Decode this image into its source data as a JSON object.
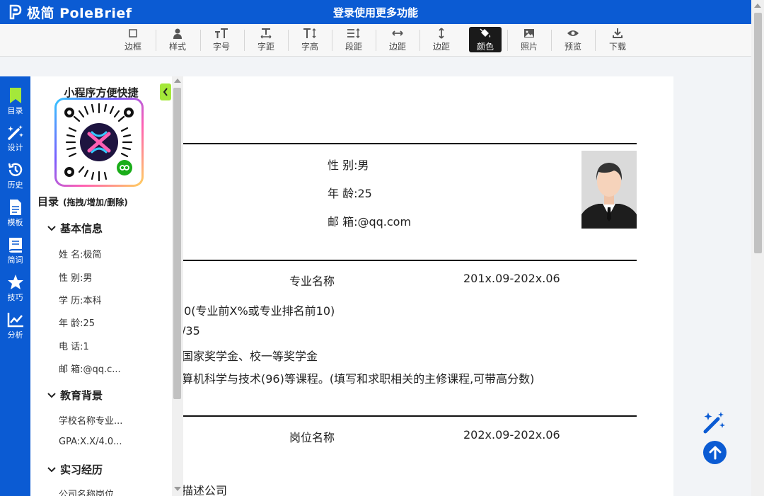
{
  "app": {
    "brand": "极简 PoleBrief",
    "login_text": "登录使用更多功能"
  },
  "toolbar": [
    {
      "label": "边框",
      "icon": "border-icon",
      "active": false
    },
    {
      "label": "样式",
      "icon": "person-icon",
      "active": false
    },
    {
      "label": "字号",
      "icon": "font-size-icon",
      "active": false
    },
    {
      "label": "字距",
      "icon": "letter-spacing-icon",
      "active": false
    },
    {
      "label": "字高",
      "icon": "line-height-icon",
      "active": false
    },
    {
      "label": "段距",
      "icon": "paragraph-spacing-icon",
      "active": false
    },
    {
      "label": "边距",
      "icon": "horizontal-margin-icon",
      "active": false
    },
    {
      "label": "边距",
      "icon": "vertical-margin-icon",
      "active": false
    },
    {
      "label": "颜色",
      "icon": "paint-bucket-icon",
      "active": true
    },
    {
      "label": "照片",
      "icon": "image-icon",
      "active": false
    },
    {
      "label": "预览",
      "icon": "eye-icon",
      "active": false
    },
    {
      "label": "下载",
      "icon": "download-icon",
      "active": false
    }
  ],
  "rail": [
    {
      "label": "目录",
      "icon": "bookmark-icon"
    },
    {
      "label": "设计",
      "icon": "magic-wand-icon"
    },
    {
      "label": "历史",
      "icon": "history-icon"
    },
    {
      "label": "模板",
      "icon": "document-icon"
    },
    {
      "label": "简词",
      "icon": "book-icon"
    },
    {
      "label": "技巧",
      "icon": "star-icon"
    },
    {
      "label": "分析",
      "icon": "chart-icon"
    }
  ],
  "sidebar": {
    "mp_title": "小程序方便快捷",
    "toc_title": "目录",
    "toc_hint": "(拖拽/增加/删除)",
    "sections": [
      {
        "title": "基本信息",
        "items": [
          "姓 名:极简",
          "性 别:男",
          "学 历:本科",
          "年 龄:25",
          "电 话:1",
          "邮 箱:@qq.c..."
        ]
      },
      {
        "title": "教育背景",
        "items": [
          "学校名称专业...",
          "GPA:X.X/4.0..."
        ]
      },
      {
        "title": "实习经历",
        "items": [
          "公司名称岗位..."
        ]
      }
    ]
  },
  "resume": {
    "gender": "性 别:男",
    "age": "年 龄:25",
    "email": "邮 箱:@qq.com",
    "edu_major": "专业名称",
    "edu_date": "201x.09-202x.06",
    "edu_line1": ".0(专业前X%或专业排名前10)",
    "edu_line2": "/35",
    "edu_line3": "国家奖学金、校一等奖学金",
    "edu_line4": "算机科学与技术(96)等课程。(填写和求职相关的主修课程,可带高分数)",
    "job_title": "岗位名称",
    "job_date": "202x.09-202x.06",
    "job_line1": "描述公司"
  },
  "colors": {
    "brand_blue": "#0b5bd3",
    "accent_green": "#a4e83a"
  }
}
